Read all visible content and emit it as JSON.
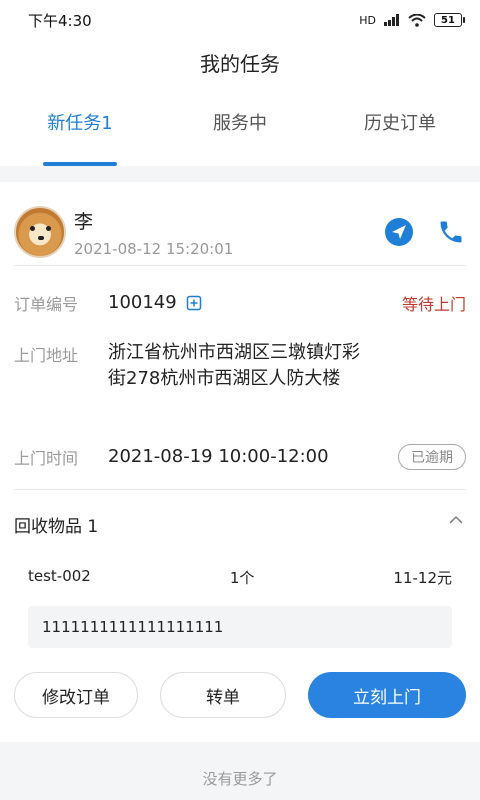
{
  "status_bar": {
    "time": "下午4:30",
    "signal": "HD",
    "battery": "51"
  },
  "title": "我的任务",
  "tabs": [
    {
      "label": "新任务1",
      "active": true
    },
    {
      "label": "服务中",
      "active": false
    },
    {
      "label": "历史订单",
      "active": false
    }
  ],
  "order": {
    "user_name": "李",
    "created_time": "2021-08-12 15:20:01",
    "order_number_label": "订单编号",
    "order_number": "100149",
    "status": "等待上门",
    "address_label": "上门地址",
    "address": "浙江省杭州市西湖区三墩镇灯彩街278杭州市西湖区人防大楼",
    "time_label": "上门时间",
    "time": "2021-08-19 10:00-12:00",
    "overdue_badge": "已逾期",
    "items_title": "回收物品 1",
    "item": {
      "name": "test-002",
      "quantity": "1个",
      "price": "11-12元"
    },
    "note": "1111111111111111111",
    "buttons": {
      "modify": "修改订单",
      "transfer": "转单",
      "go": "立刻上门"
    }
  },
  "footer_text": "没有更多了",
  "colors": {
    "accent": "#1f7fd6",
    "status_red": "#c0392b",
    "primary_button": "#2a83e0"
  },
  "icons": [
    "navigate-icon",
    "phone-icon",
    "copy-icon",
    "chevron-up-icon"
  ]
}
